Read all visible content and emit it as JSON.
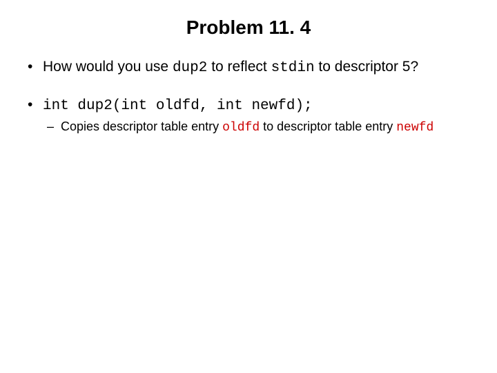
{
  "title": "Problem 11. 4",
  "b1": {
    "t1": "How would you use ",
    "c1": "dup2",
    "t2": " to reflect ",
    "c2": "stdin",
    "t3": " to descriptor 5?"
  },
  "b2": {
    "code": "int dup2(int oldfd, int newfd);",
    "sub": {
      "t1": "Copies descriptor table entry ",
      "c1": "oldfd",
      "t2": " to descriptor table entry ",
      "c2": "newfd"
    }
  }
}
